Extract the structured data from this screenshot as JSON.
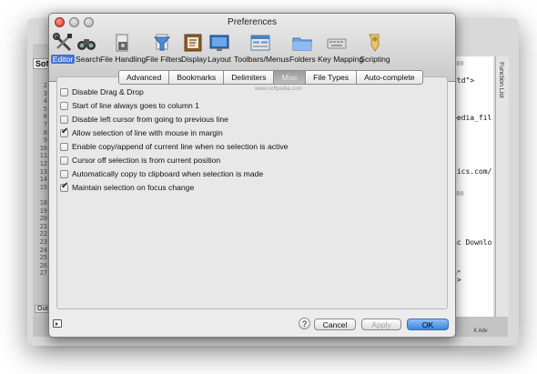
{
  "window_title": "Preferences",
  "toolbar": {
    "items": [
      {
        "label": "Editor",
        "icon": "tools-icon",
        "selected": true
      },
      {
        "label": "Search",
        "icon": "binoculars-icon",
        "selected": false
      },
      {
        "label": "File Handling",
        "icon": "file-handling-icon",
        "selected": false
      },
      {
        "label": "File Filters",
        "icon": "funnel-icon",
        "selected": false
      },
      {
        "label": "Display",
        "icon": "display-icon",
        "selected": false
      },
      {
        "label": "Layout",
        "icon": "monitor-icon",
        "selected": false
      },
      {
        "label": "Toolbars/Menus",
        "icon": "toolbars-icon",
        "selected": false
      },
      {
        "label": "Folders",
        "icon": "folder-icon",
        "selected": false
      },
      {
        "label": "Key Mapping",
        "icon": "keyboard-icon",
        "selected": false
      },
      {
        "label": "Scripting",
        "icon": "scripting-icon",
        "selected": false
      }
    ]
  },
  "tabs": [
    {
      "label": "Advanced",
      "active": false
    },
    {
      "label": "Bookmarks",
      "active": false
    },
    {
      "label": "Delimiters",
      "active": false
    },
    {
      "label": "Misc",
      "active": true
    },
    {
      "label": "File Types",
      "active": false
    },
    {
      "label": "Auto-complete",
      "active": false
    }
  ],
  "watermark": "www.softpedia.com",
  "options": [
    {
      "label": "Disable Drag & Drop",
      "checked": false
    },
    {
      "label": "Start of line always goes to column 1",
      "checked": false
    },
    {
      "label": "Disable left cursor from going to previous line",
      "checked": false
    },
    {
      "label": "Allow selection of line with mouse in margin",
      "checked": true
    },
    {
      "label": "Enable copy/append of current line when no selection is active",
      "checked": false
    },
    {
      "label": "Cursor off selection is from current position",
      "checked": false
    },
    {
      "label": "Automatically copy to clipboard when selection is made",
      "checked": false
    },
    {
      "label": "Maintain selection on focus change",
      "checked": true
    }
  ],
  "buttons": {
    "help": "?",
    "cancel": "Cancel",
    "apply": "Apply",
    "ok": "OK"
  },
  "background": {
    "tab_label": "Sof",
    "bottom_tab": "Outp",
    "line_numbers_top": [
      "2",
      "3",
      "4",
      "5",
      "6",
      "7",
      "8",
      "9",
      "10",
      "11",
      "12",
      "13",
      "14",
      "15"
    ],
    "line_numbers_bottom": [
      "18",
      "19",
      "20",
      "21",
      "22",
      "23",
      "24",
      "25",
      "26",
      "27"
    ],
    "right_code": [
      "dtd\">",
      "pedia_fil",
      "tics.com/",
      "ac Downlo",
      "=\"",
      "\">"
    ],
    "right_ruler": "100",
    "function_list": "Function List",
    "status": "X Adv"
  }
}
